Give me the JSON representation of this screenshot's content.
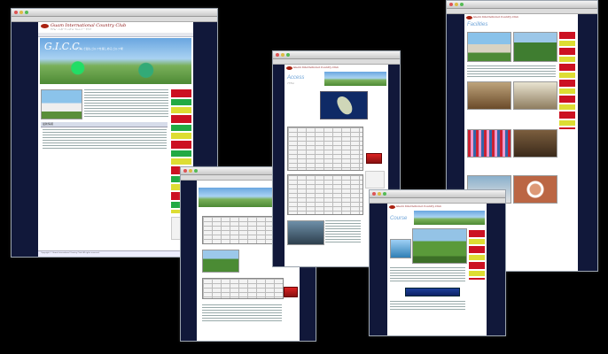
{
  "site": {
    "brand": "Guam International Country Club",
    "brand_sub": "グアム・インターナショナル・カントリー・クラブ",
    "hero_title": "G.I.C.C.",
    "hero_sub": "グアムで最もゴルフを楽しめるゴルフ場",
    "copyright": "Copyright © Guam International Country Club. All rights reserved."
  },
  "windows": {
    "home": {
      "news_heading": "最新情報"
    },
    "access": {
      "heading": "Access",
      "heading_sub": "アクセス"
    },
    "facilities": {
      "heading": "Facilities"
    },
    "course": {
      "heading": "Course"
    }
  },
  "colors": {
    "navy": "#11183a",
    "brand_red": "#8b1111",
    "hero_blue": "#6aa6e0"
  }
}
